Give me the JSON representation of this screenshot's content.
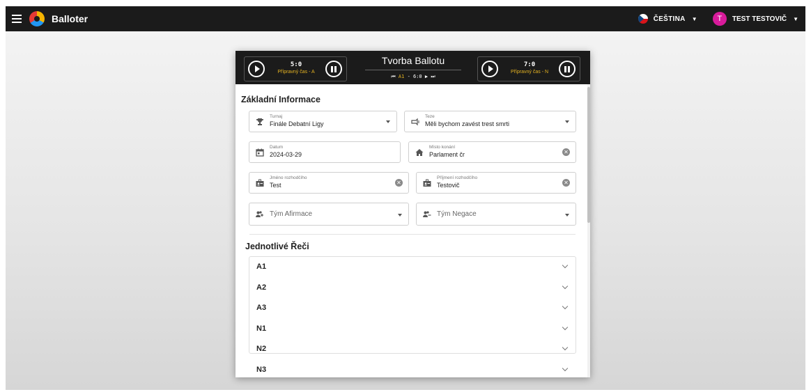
{
  "app": {
    "name": "Balloter",
    "language": "ČEŠTINA",
    "user": {
      "initial": "T",
      "name": "TEST TESTOVIČ"
    }
  },
  "timer": {
    "title": "Tvorba Ballotu",
    "left": {
      "score": "5:0",
      "label": "Přípravný čas - A"
    },
    "right": {
      "score": "7:0",
      "label": "Přípravný čas - N"
    },
    "nav": {
      "current": "A1",
      "score": "6:0"
    }
  },
  "basic": {
    "heading": "Základní Informace",
    "tournament": {
      "label": "Turnaj",
      "value": "Finále Debatní Ligy"
    },
    "motion": {
      "label": "Teze",
      "value": "Měli bychom zavést trest smrti"
    },
    "date": {
      "label": "Datum",
      "value": "2024-03-29"
    },
    "venue": {
      "label": "Místo konání",
      "value": "Parlament čr"
    },
    "judge_first": {
      "label": "Jméno rozhodčího",
      "value": "Test"
    },
    "judge_last": {
      "label": "Příjmení rozhodčího",
      "value": "Testovič"
    },
    "team_aff": {
      "placeholder": "Tým Afirmace"
    },
    "team_neg": {
      "placeholder": "Tým Negace"
    }
  },
  "speeches": {
    "heading": "Jednotlivé Řeči",
    "items": [
      {
        "label": "A1"
      },
      {
        "label": "A2"
      },
      {
        "label": "A3"
      },
      {
        "label": "N1"
      },
      {
        "label": "N2"
      },
      {
        "label": "N3"
      }
    ]
  },
  "colors": {
    "appbar": "#1b1b1b",
    "accent_yellow": "#e6b422",
    "avatar": "#d81b9b"
  }
}
